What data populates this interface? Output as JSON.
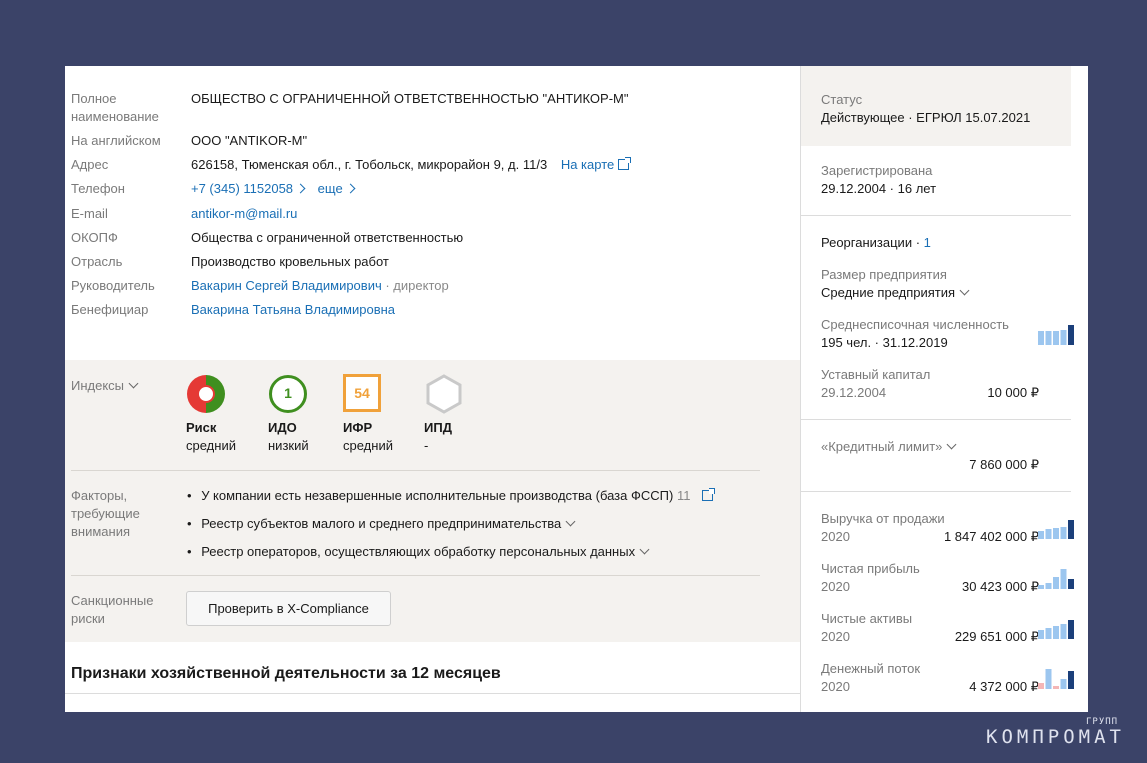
{
  "info": {
    "full_name_label": "Полное наименование",
    "full_name": "ОБЩЕСТВО С ОГРАНИЧЕННОЙ ОТВЕТСТВЕННОСТЬЮ \"АНТИКОР-М\"",
    "english_label": "На английском",
    "english": "ООО \"ANTIKOR-M\"",
    "address_label": "Адрес",
    "address": "626158, Тюменская обл., г. Тобольск, микрорайон 9, д. 11/3",
    "map_link": "На карте",
    "phone_label": "Телефон",
    "phone": "+7 (345) 1152058",
    "phone_more": "еще",
    "email_label": "E-mail",
    "email": "antikor-m@mail.ru",
    "okopf_label": "ОКОПФ",
    "okopf": "Общества с ограниченной ответственностью",
    "industry_label": "Отрасль",
    "industry": "Производство кровельных работ",
    "head_label": "Руководитель",
    "head": "Вакарин Сергей Владимирович",
    "head_role": "· директор",
    "beneficiary_label": "Бенефициар",
    "beneficiary": "Вакарина Татьяна Владимировна"
  },
  "indexes": {
    "label": "Индексы",
    "items": [
      {
        "title": "Риск",
        "sub": "средний",
        "icon": "risk-gauge-icon"
      },
      {
        "title": "ИДО",
        "sub": "низкий",
        "badge": "1",
        "color": "#3f8f1f"
      },
      {
        "title": "ИФР",
        "sub": "средний",
        "badge": "54",
        "color": "#f0a13a"
      },
      {
        "title": "ИПД",
        "sub": "-",
        "icon": "hexagon-icon"
      }
    ]
  },
  "factors": {
    "label_1": "Факторы,",
    "label_2": "требующие",
    "label_3": "внимания",
    "items": [
      {
        "text": "У компании есть незавершенные исполнительные производства (база ФССП)",
        "count": "11"
      },
      {
        "text": "Реестр субъектов малого и среднего предпринимательства"
      },
      {
        "text": "Реестр операторов, осуществляющих обработку персональных данных"
      }
    ]
  },
  "sanctions": {
    "label_1": "Санкционные",
    "label_2": "риски",
    "button": "Проверить в X-Compliance"
  },
  "section_title": "Признаки хозяйственной деятельности за 12 месяцев",
  "side": {
    "status_label": "Статус",
    "status": "Действующее · ЕГРЮЛ 15.07.2021",
    "registered_label": "Зарегистрирована",
    "registered": "29.12.2004 · 16 лет",
    "reorg_label": "Реорганизации ·",
    "reorg_count": "1",
    "size_label": "Размер предприятия",
    "size": "Средние предприятия",
    "headcount_label": "Среднесписочная численность",
    "headcount": "195 чел. · 31.12.2019",
    "capital_label": "Уставный капитал",
    "capital_date": "29.12.2004",
    "capital": "10 000 ₽",
    "credit_label": "«Кредитный лимит»",
    "credit": "7 860 000 ₽",
    "finance": [
      {
        "label": "Выручка от продажи",
        "year": "2020",
        "value": "1 847 402 000 ₽",
        "bars": [
          0.4,
          0.5,
          0.55,
          0.6,
          0.95
        ],
        "neg": []
      },
      {
        "label": "Чистая прибыль",
        "year": "2020",
        "value": "30 423 000 ₽",
        "bars": [
          0.2,
          0.3,
          0.6,
          1.0,
          0.5
        ],
        "neg": []
      },
      {
        "label": "Чистые активы",
        "year": "2020",
        "value": "229 651 000 ₽",
        "bars": [
          0.45,
          0.55,
          0.65,
          0.75,
          0.95
        ],
        "neg": []
      },
      {
        "label": "Денежный поток",
        "year": "2020",
        "value": "4 372 000 ₽",
        "bars": [
          0.3,
          1.0,
          0.15,
          0.5,
          0.9
        ],
        "neg": [
          0,
          2
        ]
      }
    ]
  },
  "colors": {
    "accent": "#1a6fb5",
    "bar_light": "#9cc6ef",
    "bar_dark": "#1b3f7a",
    "bar_neg": "#f4b6b6"
  },
  "watermark": {
    "text": "КОМПРОМАТ",
    "small": "ГРУПП"
  }
}
